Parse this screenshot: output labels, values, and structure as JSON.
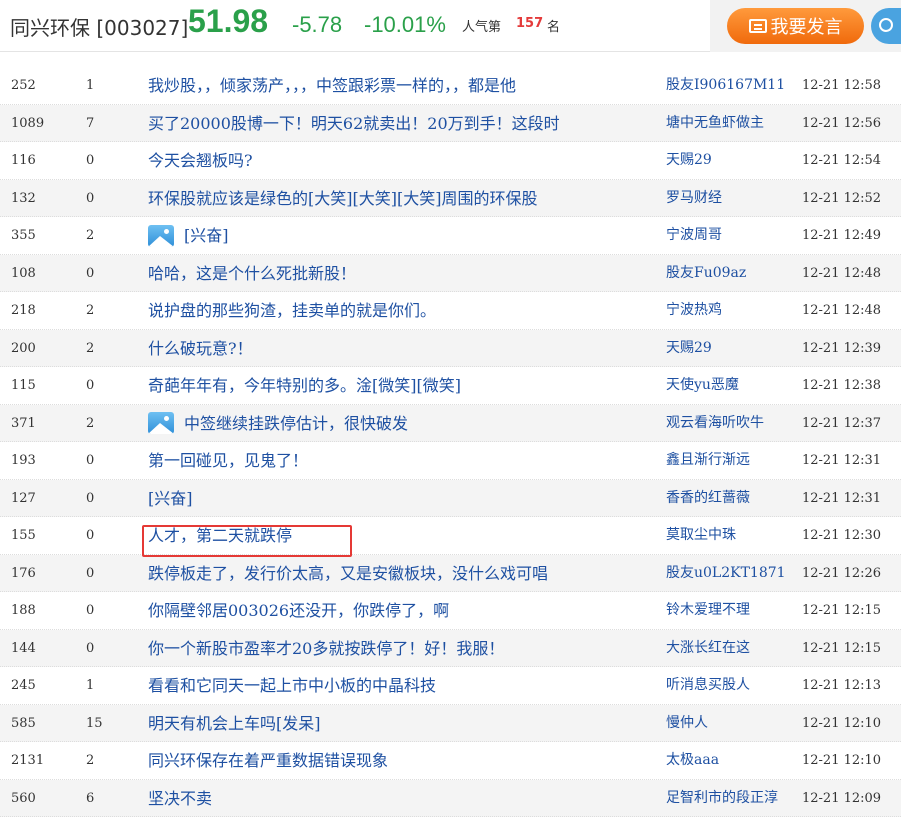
{
  "header": {
    "stock_name": "同兴环保 [003027]",
    "price": "51.98",
    "change": "-5.78",
    "change_pct": "-10.01%",
    "popularity_label": "人气第",
    "popularity_rank": "157",
    "popularity_suffix": "名",
    "post_button_label": "我要发言"
  },
  "colors": {
    "down": "#2aa04a",
    "link": "#1e50a2",
    "post_button": "#f07a1c",
    "rank": "#e43a3a",
    "highlight": "#e53935"
  },
  "posts": [
    {
      "reads": "252",
      "replies": "1",
      "title": "我炒股，，倾家荡产，，，中签跟彩票一样的，，都是他",
      "author": "股友I906167M11",
      "time": "12-21 12:58",
      "has_image": false
    },
    {
      "reads": "1089",
      "replies": "7",
      "title": "买了20000股博一下！明天62就卖出！20万到手！这段时",
      "author": "塘中无鱼虾做主",
      "time": "12-21 12:56",
      "has_image": false
    },
    {
      "reads": "116",
      "replies": "0",
      "title": "今天会翘板吗?",
      "author": "天赐29",
      "time": "12-21 12:54",
      "has_image": false
    },
    {
      "reads": "132",
      "replies": "0",
      "title": "环保股就应该是绿色的[大笑][大笑][大笑]周围的环保股",
      "author": "罗马财经",
      "time": "12-21 12:52",
      "has_image": false
    },
    {
      "reads": "355",
      "replies": "2",
      "title": "[兴奋]",
      "author": "宁波周哥",
      "time": "12-21 12:49",
      "has_image": true
    },
    {
      "reads": "108",
      "replies": "0",
      "title": "哈哈，这是个什么死批新股！",
      "author": "股友Fu09az",
      "time": "12-21 12:48",
      "has_image": false
    },
    {
      "reads": "218",
      "replies": "2",
      "title": "说护盘的那些狗渣，挂卖单的就是你们。",
      "author": "宁波热鸡",
      "time": "12-21 12:48",
      "has_image": false
    },
    {
      "reads": "200",
      "replies": "2",
      "title": "什么破玩意?！",
      "author": "天赐29",
      "time": "12-21 12:39",
      "has_image": false
    },
    {
      "reads": "115",
      "replies": "0",
      "title": "奇葩年年有，今年特别的多。淦[微笑][微笑]",
      "author": "天使yu恶魔",
      "time": "12-21 12:38",
      "has_image": false
    },
    {
      "reads": "371",
      "replies": "2",
      "title": "中签继续挂跌停估计，很快破发",
      "author": "观云看海听吹牛",
      "time": "12-21 12:37",
      "has_image": true
    },
    {
      "reads": "193",
      "replies": "0",
      "title": "第一回碰见，见鬼了！",
      "author": "鑫且渐行渐远",
      "time": "12-21 12:31",
      "has_image": false
    },
    {
      "reads": "127",
      "replies": "0",
      "title": "[兴奋]",
      "author": "香香的红蔷薇",
      "time": "12-21 12:31",
      "has_image": false
    },
    {
      "reads": "155",
      "replies": "0",
      "title": "人才，第二天就跌停",
      "author": "莫取尘中珠",
      "time": "12-21 12:30",
      "has_image": false
    },
    {
      "reads": "176",
      "replies": "0",
      "title": "跌停板走了，发行价太高，又是安徽板块，没什么戏可唱",
      "author": "股友u0L2KT1871",
      "time": "12-21 12:26",
      "has_image": false
    },
    {
      "reads": "188",
      "replies": "0",
      "title": "你隔壁邻居003026还没开，你跌停了，啊",
      "author": "铃木爱理不理",
      "time": "12-21 12:15",
      "has_image": false
    },
    {
      "reads": "144",
      "replies": "0",
      "title": "你一个新股市盈率才20多就按跌停了！好！我服！",
      "author": "大涨长红在这",
      "time": "12-21 12:15",
      "has_image": false
    },
    {
      "reads": "245",
      "replies": "1",
      "title": "看看和它同天一起上市中小板的中晶科技",
      "author": "听消息买股人",
      "time": "12-21 12:13",
      "has_image": false
    },
    {
      "reads": "585",
      "replies": "15",
      "title": "明天有机会上车吗[发呆]",
      "author": "慢仲人",
      "time": "12-21 12:10",
      "has_image": false
    },
    {
      "reads": "2131",
      "replies": "2",
      "title": "同兴环保存在着严重数据错误现象",
      "author": "太极aaa",
      "time": "12-21 12:10",
      "has_image": false
    },
    {
      "reads": "560",
      "replies": "6",
      "title": "坚决不卖",
      "author": "足智利市的段正淳",
      "time": "12-21 12:09",
      "has_image": false
    }
  ]
}
